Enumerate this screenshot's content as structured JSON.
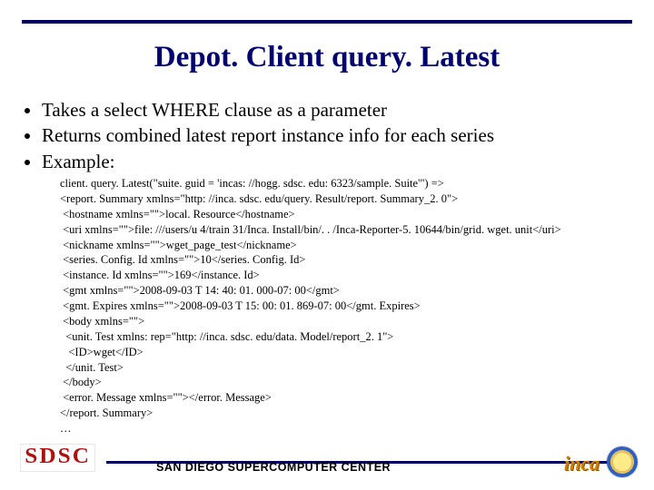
{
  "title": "Depot. Client query. Latest",
  "bullets": [
    "Takes a select WHERE clause as a parameter",
    "Returns combined latest report instance info for each series",
    "Example:"
  ],
  "code_lines": [
    "client. query. Latest(\"suite. guid = 'incas: //hogg. sdsc. edu: 6323/sample. Suite'\") =>",
    "<report. Summary xmlns=\"http: //inca. sdsc. edu/query. Result/report. Summary_2. 0\">",
    " <hostname xmlns=\"\">local. Resource</hostname>",
    " <uri xmlns=\"\">file: ///users/u 4/train 31/Inca. Install/bin/. . /Inca-Reporter-5. 10644/bin/grid. wget. unit</uri>",
    " <nickname xmlns=\"\">wget_page_test</nickname>",
    " <series. Config. Id xmlns=\"\">10</series. Config. Id>",
    " <instance. Id xmlns=\"\">169</instance. Id>",
    " <gmt xmlns=\"\">2008-09-03 T 14: 40: 01. 000-07: 00</gmt>",
    " <gmt. Expires xmlns=\"\">2008-09-03 T 15: 00: 01. 869-07: 00</gmt. Expires>",
    " <body xmlns=\"\">",
    "  <unit. Test xmlns: rep=\"http: //inca. sdsc. edu/data. Model/report_2. 1\">",
    "   <ID>wget</ID>",
    "  </unit. Test>",
    " </body>",
    " <error. Message xmlns=\"\"></error. Message>",
    "</report. Summary>",
    "…"
  ],
  "footer": {
    "org_logo_text": "SDSC",
    "org_full_name": "SAN DIEGO SUPERCOMPUTER CENTER",
    "product_logo_text": "inca"
  }
}
